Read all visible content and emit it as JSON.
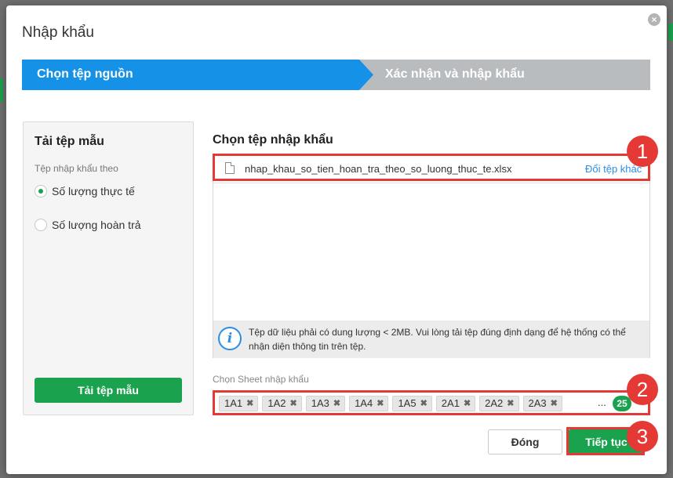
{
  "dialog": {
    "title": "Nhập khẩu",
    "close_icon": "×"
  },
  "steps": [
    {
      "label": "Chọn tệp nguồn",
      "active": true,
      "color": "#1591e8"
    },
    {
      "label": "Xác nhận và nhập khẩu",
      "active": false,
      "color": "#b9bcbf"
    }
  ],
  "template_panel": {
    "title": "Tải tệp mẫu",
    "subtitle": "Tệp nhập khẩu theo",
    "options": [
      {
        "label": "Số lượng thực tế",
        "checked": true
      },
      {
        "label": "Số lượng hoàn trả",
        "checked": false
      }
    ],
    "download_button": "Tải tệp mẫu"
  },
  "import_file": {
    "title": "Chọn tệp nhập khẩu",
    "file_name": "nhap_khau_so_tien_hoan_tra_theo_so_luong_thuc_te.xlsx",
    "change_link": "Đổi tệp khác",
    "info_text": "Tệp dữ liệu phải có dung lượng < 2MB. Vui lòng tải tệp đúng định dạng để hệ thống có thể nhận diện thông tin trên tệp.",
    "info_icon": "i"
  },
  "sheet_select": {
    "label": "Chọn Sheet nhập khẩu",
    "tags": [
      "1A1",
      "1A2",
      "1A3",
      "1A4",
      "1A5",
      "2A1",
      "2A2",
      "2A3"
    ],
    "remove_icon": "✖",
    "more": "...",
    "count": "25"
  },
  "footer": {
    "close_button": "Đóng",
    "next_button": "Tiếp tục"
  },
  "markers": [
    "1",
    "2",
    "3"
  ],
  "colors": {
    "accent_green": "#1aa24e",
    "step_active": "#1591e8",
    "step_inactive": "#b9bcbf",
    "highlight_red": "#e53935",
    "link_blue": "#2b8ee6"
  }
}
